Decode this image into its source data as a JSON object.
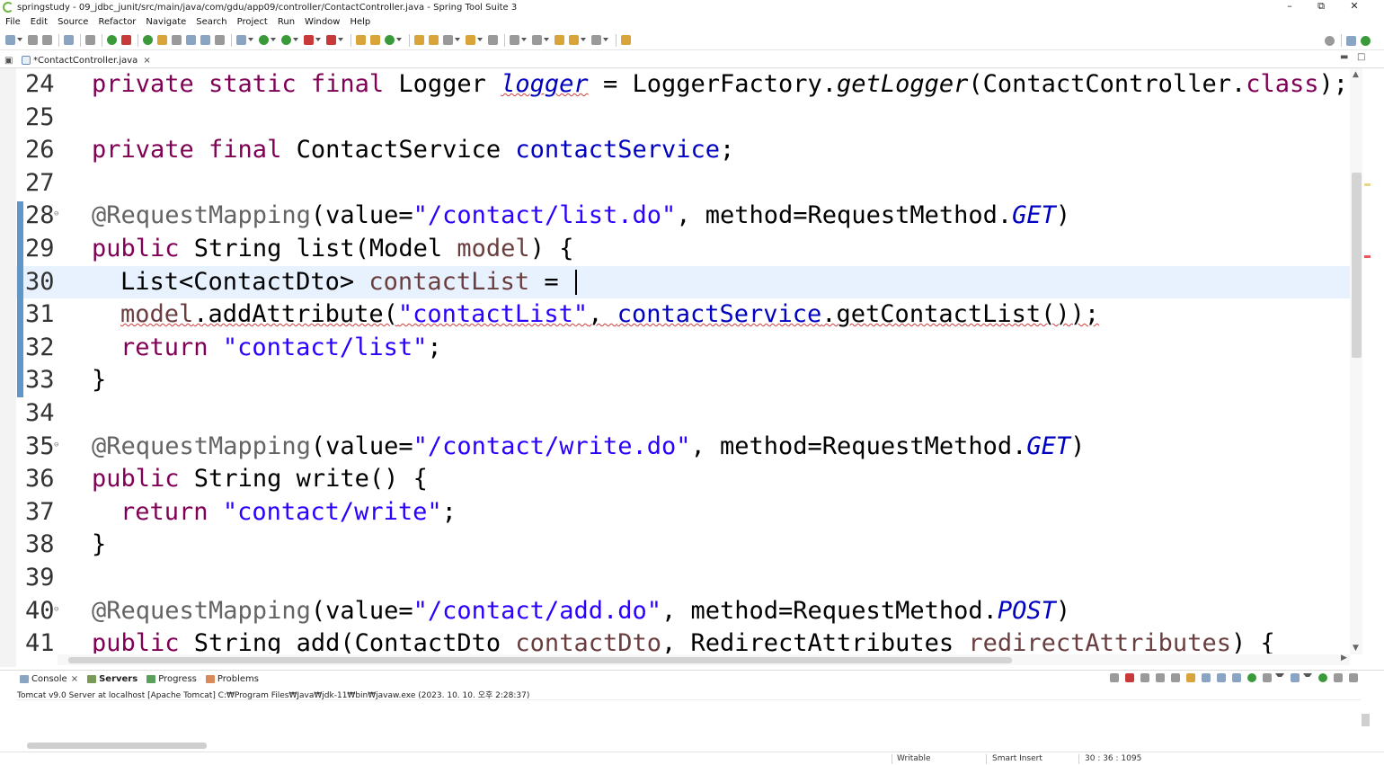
{
  "window": {
    "title": "springstudy - 09_jdbc_junit/src/main/java/com/gdu/app09/controller/ContactController.java - Spring Tool Suite 3",
    "minimize": "–",
    "restore": "⧉",
    "close": "✕"
  },
  "menu": [
    "File",
    "Edit",
    "Source",
    "Refactor",
    "Navigate",
    "Search",
    "Project",
    "Run",
    "Window",
    "Help"
  ],
  "editor_tab": {
    "label": "*ContactController.java",
    "close": "×"
  },
  "code_lines": [
    {
      "num": "24"
    },
    {
      "num": "25"
    },
    {
      "num": "26"
    },
    {
      "num": "27"
    },
    {
      "num": "28"
    },
    {
      "num": "29"
    },
    {
      "num": "30"
    },
    {
      "num": "31"
    },
    {
      "num": "32"
    },
    {
      "num": "33"
    },
    {
      "num": "34"
    },
    {
      "num": "35"
    },
    {
      "num": "36"
    },
    {
      "num": "37"
    },
    {
      "num": "38"
    },
    {
      "num": "39"
    },
    {
      "num": "40"
    },
    {
      "num": "41"
    }
  ],
  "code": {
    "l24": {
      "kw": "private static final",
      "type": " Logger ",
      "field": "logger",
      "eq": " = LoggerFactory.",
      "method": "getLogger",
      "rest": "(ContactController.",
      "kw2": "class",
      "end": ");"
    },
    "l26": {
      "kw": "private final",
      "type": " ContactService ",
      "field": "contactService",
      "end": ";"
    },
    "l28": {
      "ann": "@RequestMapping",
      "p1": "(value=",
      "str": "\"/contact/list.do\"",
      "p2": ", method=RequestMethod.",
      "const": "GET",
      "end": ")"
    },
    "l29": {
      "kw": "public",
      "rest": " String list(Model ",
      "param": "model",
      "end": ") {"
    },
    "l30": {
      "type": "List<ContactDto> ",
      "local": "contactList",
      "end": " = "
    },
    "l31": {
      "param": "model",
      "p1": ".addAttribute(",
      "str": "\"contactList\"",
      "p2": ", ",
      "field": "contactService",
      "end": ".getContactList());"
    },
    "l32": {
      "kw": "return",
      "sp": " ",
      "str": "\"contact/list\"",
      "end": ";"
    },
    "l33": {
      "text": "}"
    },
    "l35": {
      "ann": "@RequestMapping",
      "p1": "(value=",
      "str": "\"/contact/write.do\"",
      "p2": ", method=RequestMethod.",
      "const": "GET",
      "end": ")"
    },
    "l36": {
      "kw": "public",
      "rest": " String write() {"
    },
    "l37": {
      "kw": "return",
      "sp": " ",
      "str": "\"contact/write\"",
      "end": ";"
    },
    "l38": {
      "text": "}"
    },
    "l40": {
      "ann": "@RequestMapping",
      "p1": "(value=",
      "str": "\"/contact/add.do\"",
      "p2": ", method=RequestMethod.",
      "const": "POST",
      "end": ")"
    },
    "l41": {
      "kw": "public",
      "rest": " String add(ContactDto ",
      "param": "contactDto",
      "p2": ", RedirectAttributes ",
      "param2": "redirectAttributes",
      "end": ") {"
    }
  },
  "bottom_tabs": {
    "console": "Console",
    "servers": "Servers",
    "progress": "Progress",
    "problems": "Problems",
    "close": "×"
  },
  "console_description": "Tomcat v9.0 Server at localhost [Apache Tomcat] C:₩Program Files₩Java₩jdk-11₩bin₩javaw.exe  (2023. 10. 10. 오후 2:28:37)",
  "status": {
    "writable": "Writable",
    "insert_mode": "Smart Insert",
    "position": "30 : 36 : 1095"
  },
  "colors": {
    "keyword": "#7f0055",
    "string": "#2a00ff",
    "field": "#0000c0",
    "annotation": "#646464",
    "current_line": "#e8f2fe",
    "change_ruler": "#5f97c9"
  }
}
